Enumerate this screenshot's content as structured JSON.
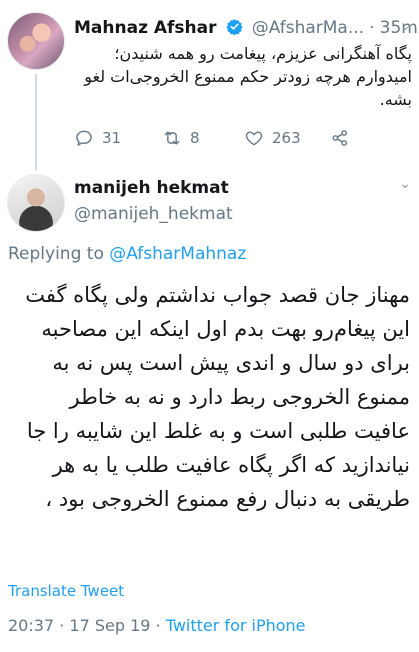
{
  "parent_tweet": {
    "display_name": "Mahnaz Afshar",
    "handle": "@AfsharMa...",
    "separator": "·",
    "time": "35m",
    "caret": "⌄",
    "text": "پگاه آهنگرانی عزیزم، پیغامت رو همه شنیدن؛ امیدوارم هرچه زودتر حکم ممنوع الخروجی‌ات لغو بشه.",
    "replies": "31",
    "retweets": "8",
    "likes": "263",
    "colors": {
      "verified": "#1da1f2"
    }
  },
  "main_tweet": {
    "display_name": "manijeh hekmat",
    "handle": "@manijeh_hekmat",
    "caret": "⌄",
    "replying_prefix": "Replying to ",
    "replying_to": "@AfsharMahnaz",
    "text": "مهناز جان قصد جواب نداشتم ولی پگاه گفت این پیغام‌رو بهت بدم اول اینکه این مصاحبه برای دو سال و اندی پیش است پس نه به ممنوع الخروجی ربط دارد و نه به خاطر عافیت طلبی است و به غلط این شایبه را جا نیاندازید که اگر پگاه عافیت طلب یا به هر طریقی به دنبال رفع ممنوع الخروجی بود ،",
    "translate_label": "Translate Tweet",
    "time": "20:37",
    "separator": "·",
    "date": "17 Sep 19",
    "source": "Twitter for iPhone"
  }
}
